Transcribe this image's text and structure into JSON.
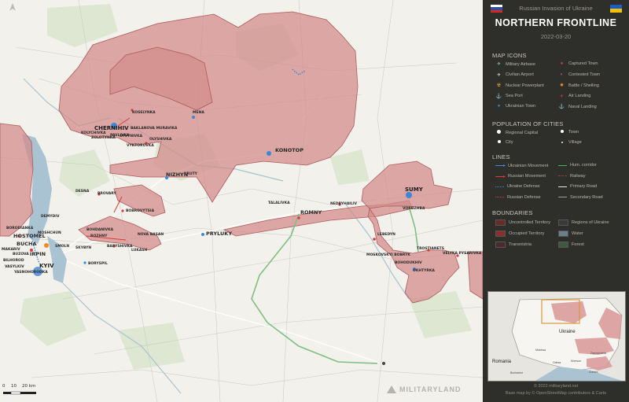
{
  "header": {
    "subtitle": "Russian Invasion of Ukraine",
    "title": "NORTHERN FRONTLINE",
    "date": "2022-03-20"
  },
  "legend": {
    "map_icons_heading": "MAP ICONS",
    "map_icons": [
      {
        "label": "Military Airbase",
        "icon": "airbase-icon",
        "glyph": "✈",
        "color": "#9ec4d6"
      },
      {
        "label": "Captured Town",
        "icon": "captured-town-icon",
        "glyph": "●",
        "color": "#d93a3a"
      },
      {
        "label": "Civilian Airport",
        "icon": "airport-icon",
        "glyph": "✈",
        "color": "#e6e6e6"
      },
      {
        "label": "Contested Town",
        "icon": "contested-town-icon",
        "glyph": "◐",
        "color": "#c05a9a"
      },
      {
        "label": "Nuclear Powerplant",
        "icon": "nuclear-icon",
        "glyph": "☢",
        "color": "#f0b030"
      },
      {
        "label": "Battle / Shelling",
        "icon": "battle-icon",
        "glyph": "✹",
        "color": "#f08a2a"
      },
      {
        "label": "Sea Port",
        "icon": "anchor-icon",
        "glyph": "⚓",
        "color": "#d8d8d8"
      },
      {
        "label": "Air Landing",
        "icon": "air-landing-icon",
        "glyph": "✈",
        "color": "#d93a3a"
      },
      {
        "label": "Ukrainian Town",
        "icon": "ukrainian-town-icon",
        "glyph": "●",
        "color": "#3c87d6"
      },
      {
        "label": "Naval Landing",
        "icon": "naval-landing-icon",
        "glyph": "⚓",
        "color": "#d93a3a"
      }
    ],
    "population_heading": "POPULATION OF CITIES",
    "population": [
      {
        "label": "Regional Capital",
        "size": "large"
      },
      {
        "label": "Town",
        "size": "medium"
      },
      {
        "label": "City",
        "size": "medium"
      },
      {
        "label": "Village",
        "size": "small"
      }
    ],
    "lines_heading": "LINES",
    "lines": [
      {
        "label": "Ukrainian Movement",
        "color": "#3c87d6",
        "style": "arrow"
      },
      {
        "label": "Hum. corridor",
        "color": "#4caf50",
        "style": "solid"
      },
      {
        "label": "Russian Movement",
        "color": "#d93a3a",
        "style": "arrow"
      },
      {
        "label": "Railway",
        "color": "#8a3a3a",
        "style": "dashed"
      },
      {
        "label": "Ukraine Defense",
        "color": "#3c87d6",
        "style": "dotted"
      },
      {
        "label": "Primary Road",
        "color": "#e8e8e8",
        "style": "solid"
      },
      {
        "label": "Russian Defense",
        "color": "#d93a3a",
        "style": "dotted"
      },
      {
        "label": "Secondary Road",
        "color": "#9a9a9a",
        "style": "solid"
      }
    ],
    "boundaries_heading": "BOUNDARIES",
    "boundaries": [
      {
        "label": "Uncontrolled Territory",
        "color": "#6a2a2a"
      },
      {
        "label": "Regions of Ukraine",
        "color": "#3a3a3a"
      },
      {
        "label": "Occupied Territory",
        "color": "#8a2e2e"
      },
      {
        "label": "Water",
        "color": "#6d7f8a"
      },
      {
        "label": "Transnistria",
        "color": "#4a2a2a"
      },
      {
        "label": "Forest",
        "color": "#3f5a3a"
      }
    ]
  },
  "inset": {
    "labels": [
      "Ukraine",
      "Romania",
      "Moldova",
      "Bucharest",
      "Crimea",
      "Zaporizhzhia",
      "Kherson",
      "Odesa"
    ]
  },
  "footer": {
    "copyright": "© 2022 militaryland.net",
    "basemap": "Base map by © OpenStreetMap contributors & Carto",
    "brand": "MILITARYLAND"
  },
  "scale": {
    "labels": [
      "0",
      "10",
      "20 km"
    ]
  },
  "towns": [
    {
      "name": "CHERNIHIV",
      "cls": "reg"
    },
    {
      "name": "KOSELYNKA",
      "cls": ""
    },
    {
      "name": "BAKLANOVA MURAVIKA",
      "cls": ""
    },
    {
      "name": "KOLYCHIVKA",
      "cls": ""
    },
    {
      "name": "ZOLOTYNKA",
      "cls": ""
    },
    {
      "name": "PAVLIVKA",
      "cls": ""
    },
    {
      "name": "SYVYNIVKA",
      "cls": ""
    },
    {
      "name": "OLYSHIVKA",
      "cls": ""
    },
    {
      "name": "VYKTOROVKA",
      "cls": ""
    },
    {
      "name": "MENA",
      "cls": ""
    },
    {
      "name": "KONOTOP",
      "cls": "big"
    },
    {
      "name": "NIZHYN",
      "cls": ""
    },
    {
      "name": "KRUTY",
      "cls": ""
    },
    {
      "name": "DESNA",
      "cls": ""
    },
    {
      "name": "BROVARY",
      "cls": ""
    },
    {
      "name": "BOHDANIVKA",
      "cls": ""
    },
    {
      "name": "ROZHNY",
      "cls": ""
    },
    {
      "name": "SKYBYN",
      "cls": ""
    },
    {
      "name": "BOBROVYTSIA",
      "cls": ""
    },
    {
      "name": "NOVA BASAN",
      "cls": ""
    },
    {
      "name": "LUKASH",
      "cls": ""
    },
    {
      "name": "BARYSHIVKA",
      "cls": ""
    },
    {
      "name": "BORYSPIL",
      "cls": ""
    },
    {
      "name": "PRYLUKY",
      "cls": ""
    },
    {
      "name": "TALALIVKA",
      "cls": ""
    },
    {
      "name": "ROMNY",
      "cls": ""
    },
    {
      "name": "NEDRYHAILIV",
      "cls": ""
    },
    {
      "name": "SUMY",
      "cls": "reg"
    },
    {
      "name": "VOROZHBA",
      "cls": ""
    },
    {
      "name": "LEBEDYN",
      "cls": ""
    },
    {
      "name": "TROSTIANETS",
      "cls": ""
    },
    {
      "name": "VELYKA PYSARIVKA",
      "cls": ""
    },
    {
      "name": "OKHTYRKA",
      "cls": ""
    },
    {
      "name": "BOHODUKHIV",
      "cls": ""
    },
    {
      "name": "MOSKOVSKYI BOBRYK",
      "cls": ""
    },
    {
      "name": "DEMYDIV",
      "cls": ""
    },
    {
      "name": "BORODIANKA",
      "cls": ""
    },
    {
      "name": "HOSTOMEL",
      "cls": "big"
    },
    {
      "name": "MOSHCHUN",
      "cls": ""
    },
    {
      "name": "BUCHA",
      "cls": "big"
    },
    {
      "name": "IRPIN",
      "cls": "big"
    },
    {
      "name": "KYIV",
      "cls": "reg"
    },
    {
      "name": "MAKARIV",
      "cls": ""
    },
    {
      "name": "BILHOROD",
      "cls": ""
    },
    {
      "name": "VASYLKIV",
      "cls": ""
    },
    {
      "name": "YASNOHORODKA",
      "cls": ""
    },
    {
      "name": "BUZOVA",
      "cls": ""
    },
    {
      "name": "SMOLN",
      "cls": ""
    }
  ]
}
